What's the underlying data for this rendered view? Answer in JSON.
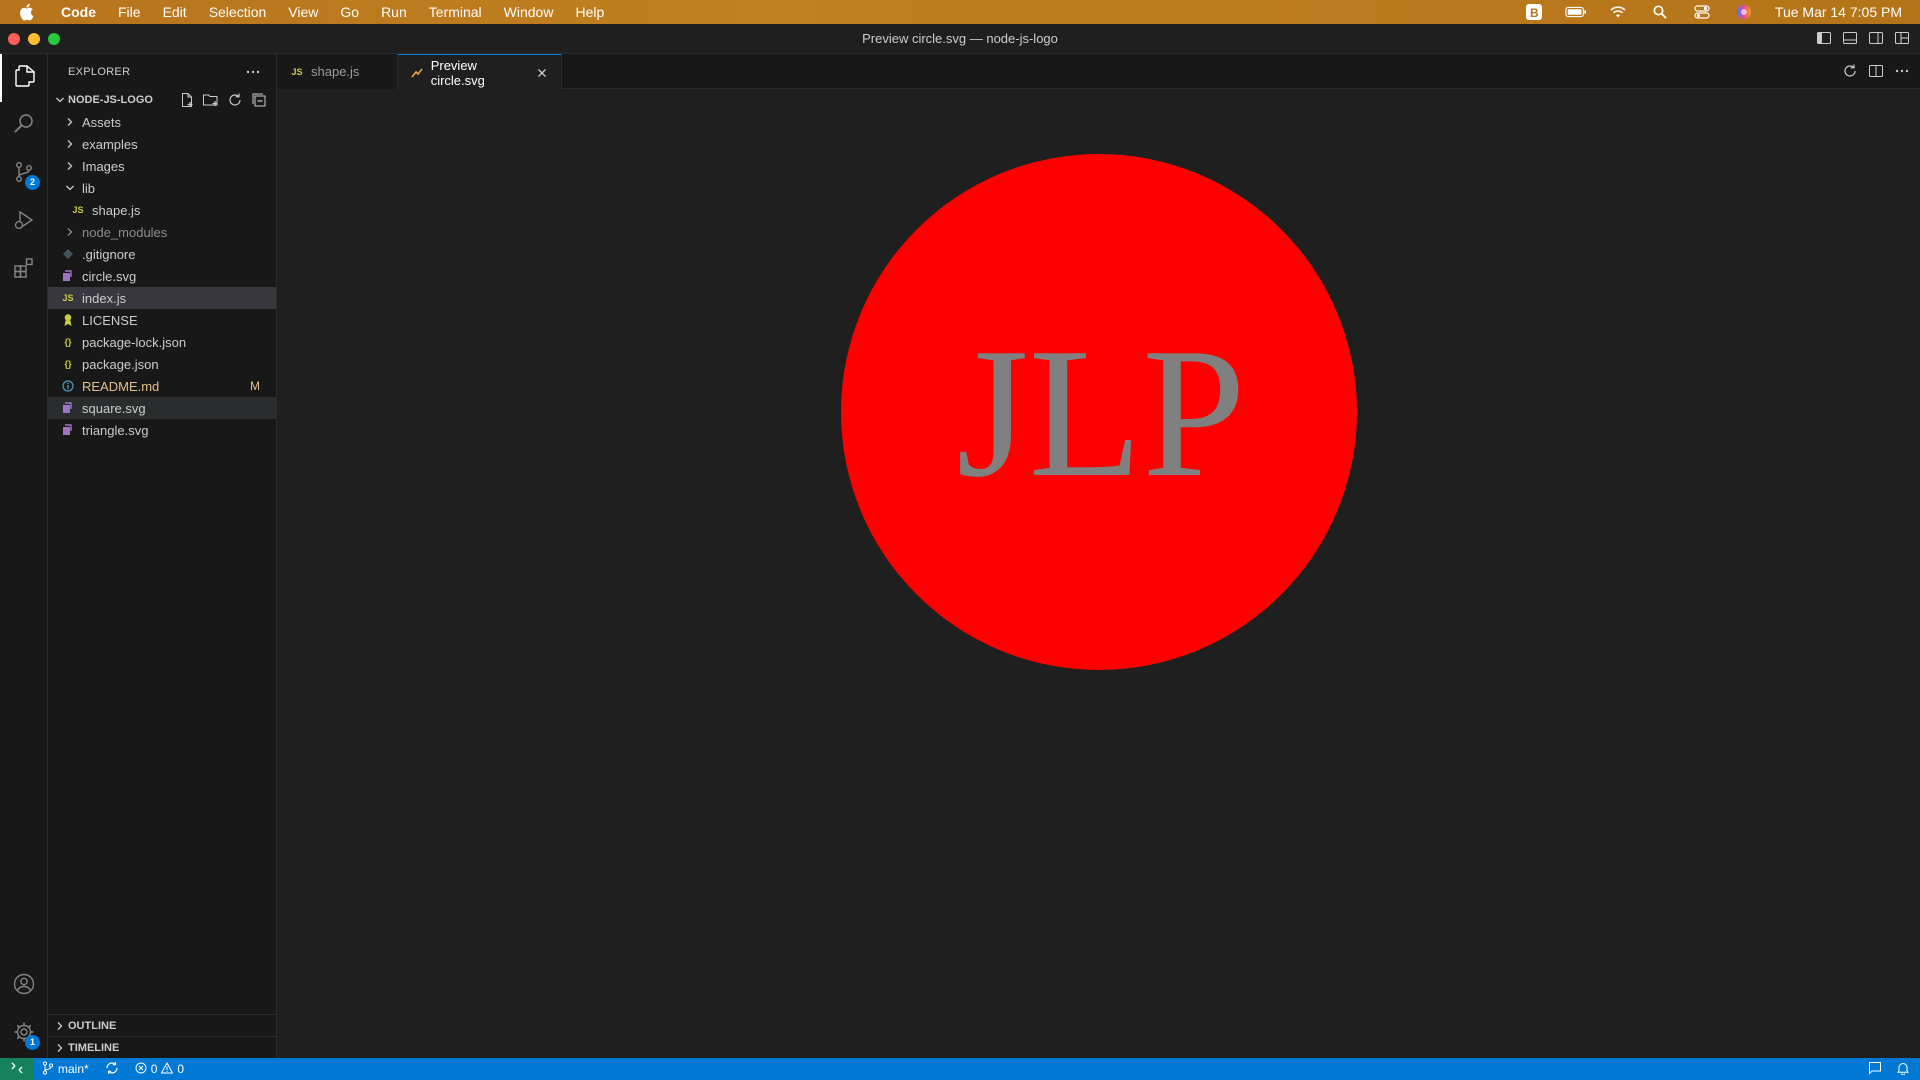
{
  "menubar": {
    "app_name": "Code",
    "items": [
      "File",
      "Edit",
      "Selection",
      "View",
      "Go",
      "Run",
      "Terminal",
      "Window",
      "Help"
    ],
    "clock": "Tue Mar 14  7:05 PM"
  },
  "window": {
    "title": "Preview circle.svg — node-js-logo"
  },
  "sidebar": {
    "header": "EXPLORER",
    "folder": "NODE-JS-LOGO",
    "tree": [
      {
        "label": "Assets",
        "type": "folder"
      },
      {
        "label": "examples",
        "type": "folder"
      },
      {
        "label": "Images",
        "type": "folder"
      },
      {
        "label": "lib",
        "type": "folder-open"
      },
      {
        "label": "shape.js",
        "type": "js"
      },
      {
        "label": "node_modules",
        "type": "folder"
      },
      {
        "label": ".gitignore",
        "type": "git"
      },
      {
        "label": "circle.svg",
        "type": "svg"
      },
      {
        "label": "index.js",
        "type": "js"
      },
      {
        "label": "LICENSE",
        "type": "license"
      },
      {
        "label": "package-lock.json",
        "type": "json"
      },
      {
        "label": "package.json",
        "type": "json"
      },
      {
        "label": "README.md",
        "type": "info",
        "mark": "M"
      },
      {
        "label": "square.svg",
        "type": "svg"
      },
      {
        "label": "triangle.svg",
        "type": "svg"
      }
    ],
    "outline": "OUTLINE",
    "timeline": "TIMELINE",
    "scm_badge": "2",
    "settings_badge": "1"
  },
  "tabs": [
    {
      "label": "shape.js",
      "icon": "JS",
      "active": false
    },
    {
      "label": "Preview circle.svg",
      "active": true
    }
  ],
  "preview": {
    "text": "JLP",
    "circle_color": "#ff0000",
    "text_color": "#808080"
  },
  "statusbar": {
    "branch": "main*",
    "errors": "0",
    "warnings": "0"
  },
  "colors": {
    "accent": "#0078d4",
    "modified": "#e2c08d"
  }
}
